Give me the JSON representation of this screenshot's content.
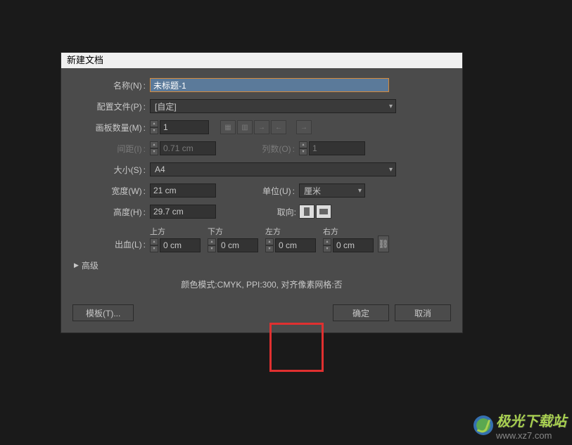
{
  "dialog": {
    "title": "新建文档",
    "name_label": "名称(N)",
    "name_value": "未标题-1",
    "profile_label": "配置文件(P)",
    "profile_value": "[自定]",
    "artboard_count_label": "画板数量(M)",
    "artboard_count_value": "1",
    "spacing_label": "间距(I)",
    "spacing_value": "0.71 cm",
    "columns_label": "列数(O)",
    "columns_value": "1",
    "size_label": "大小(S)",
    "size_value": "A4",
    "width_label": "宽度(W)",
    "width_value": "21 cm",
    "units_label": "单位(U)",
    "units_value": "厘米",
    "height_label": "高度(H)",
    "height_value": "29.7 cm",
    "orientation_label": "取向:",
    "bleed_label": "出血(L)",
    "bleed_top": "上方",
    "bleed_bottom": "下方",
    "bleed_left": "左方",
    "bleed_right": "右方",
    "bleed_value": "0 cm",
    "advanced_label": "高级",
    "mode_info": "颜色模式:CMYK, PPI:300, 对齐像素网格:否",
    "template_btn": "模板(T)...",
    "ok_btn": "确定",
    "cancel_btn": "取消"
  },
  "watermark": {
    "brand": "极光下载站",
    "url": "www.xz7.com"
  }
}
